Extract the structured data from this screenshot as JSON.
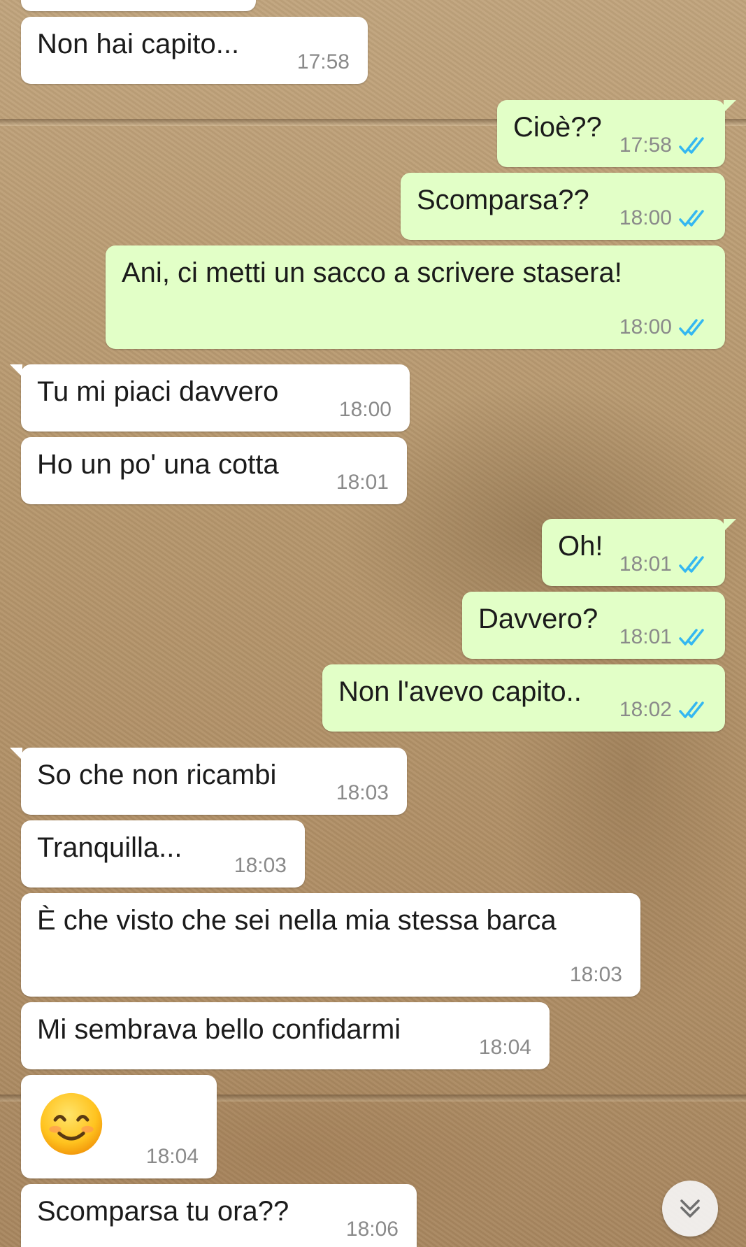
{
  "messages": [
    {
      "dir": "in",
      "text": "Non hai capito...",
      "time": "17:58"
    },
    {
      "dir": "out",
      "text": "Cioè??",
      "time": "17:58"
    },
    {
      "dir": "out",
      "text": "Scomparsa??",
      "time": "18:00"
    },
    {
      "dir": "out",
      "text": "Ani, ci metti un sacco a scrivere stasera!",
      "time": "18:00"
    },
    {
      "dir": "in",
      "text": "Tu mi piaci davvero",
      "time": "18:00"
    },
    {
      "dir": "in",
      "text": "Ho un po' una cotta",
      "time": "18:01"
    },
    {
      "dir": "out",
      "text": "Oh!",
      "time": "18:01"
    },
    {
      "dir": "out",
      "text": "Davvero?",
      "time": "18:01"
    },
    {
      "dir": "out",
      "text": "Non l'avevo capito..",
      "time": "18:02"
    },
    {
      "dir": "in",
      "text": "So che non ricambi",
      "time": "18:03"
    },
    {
      "dir": "in",
      "text": "Tranquilla...",
      "time": "18:03"
    },
    {
      "dir": "in",
      "text": "È che visto che sei nella mia stessa barca",
      "time": "18:03"
    },
    {
      "dir": "in",
      "text": "Mi sembrava bello confidarmi",
      "time": "18:04"
    },
    {
      "dir": "in",
      "text": "",
      "emoji": "smiling-face-icon",
      "time": "18:04"
    },
    {
      "dir": "in",
      "text": "Scomparsa tu ora??",
      "time": "18:06"
    }
  ],
  "icons": {
    "read_receipt": "double-check-icon",
    "scroll": "chevron-double-down-icon"
  },
  "colors": {
    "incoming": "#ffffff",
    "outgoing": "#e2ffc7",
    "tick": "#34b7f1",
    "time": "#8a8a8a"
  }
}
